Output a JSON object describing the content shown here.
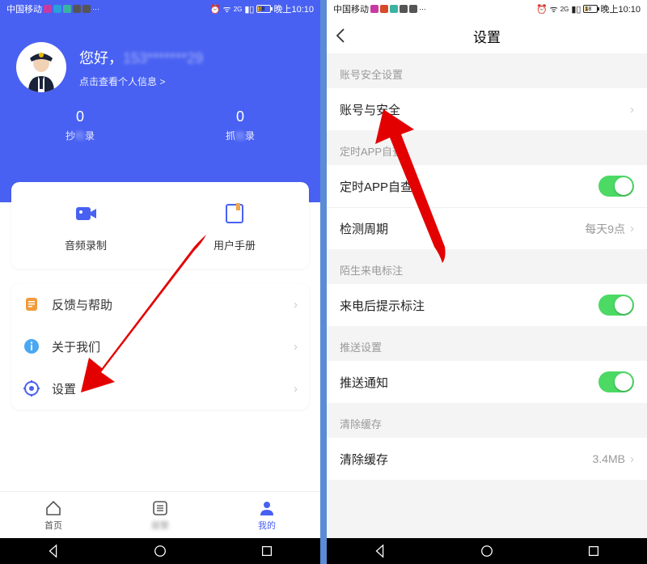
{
  "status": {
    "carrier": "中国移动",
    "time": "晚上10:10",
    "battery_text": "18"
  },
  "left": {
    "greeting": "您好，",
    "masked_phone": "153*******29",
    "sublink": "点击查看个人信息 >",
    "stats": [
      {
        "num": "0",
        "label_prefix": "抄",
        "label_blur": "检",
        "label_suffix": "录"
      },
      {
        "num": "0",
        "label_prefix": "抓",
        "label_blur": "拍",
        "label_suffix": "录"
      }
    ],
    "icon_card": [
      {
        "label": "音频录制"
      },
      {
        "label": "用户手册"
      }
    ],
    "menu": [
      {
        "label": "反馈与帮助"
      },
      {
        "label": "关于我们"
      },
      {
        "label": "设置"
      }
    ],
    "tabs": [
      {
        "label": "首页"
      },
      {
        "label_blur": "报警"
      },
      {
        "label": "我的"
      }
    ]
  },
  "right": {
    "title": "设置",
    "sections": [
      {
        "title": "账号安全设置",
        "cells": [
          {
            "label": "账号与安全",
            "type": "nav"
          }
        ]
      },
      {
        "title": "定时APP自查",
        "cells": [
          {
            "label": "定时APP自查",
            "type": "switch",
            "on": true
          },
          {
            "label": "检测周期",
            "type": "value",
            "value": "每天9点"
          }
        ]
      },
      {
        "title": "陌生来电标注",
        "cells": [
          {
            "label": "来电后提示标注",
            "type": "switch",
            "on": true
          }
        ]
      },
      {
        "title": "推送设置",
        "cells": [
          {
            "label": "推送通知",
            "type": "switch",
            "on": true
          }
        ]
      },
      {
        "title": "清除缓存",
        "cells": [
          {
            "label": "清除缓存",
            "type": "value",
            "value": "3.4MB"
          }
        ]
      }
    ]
  }
}
